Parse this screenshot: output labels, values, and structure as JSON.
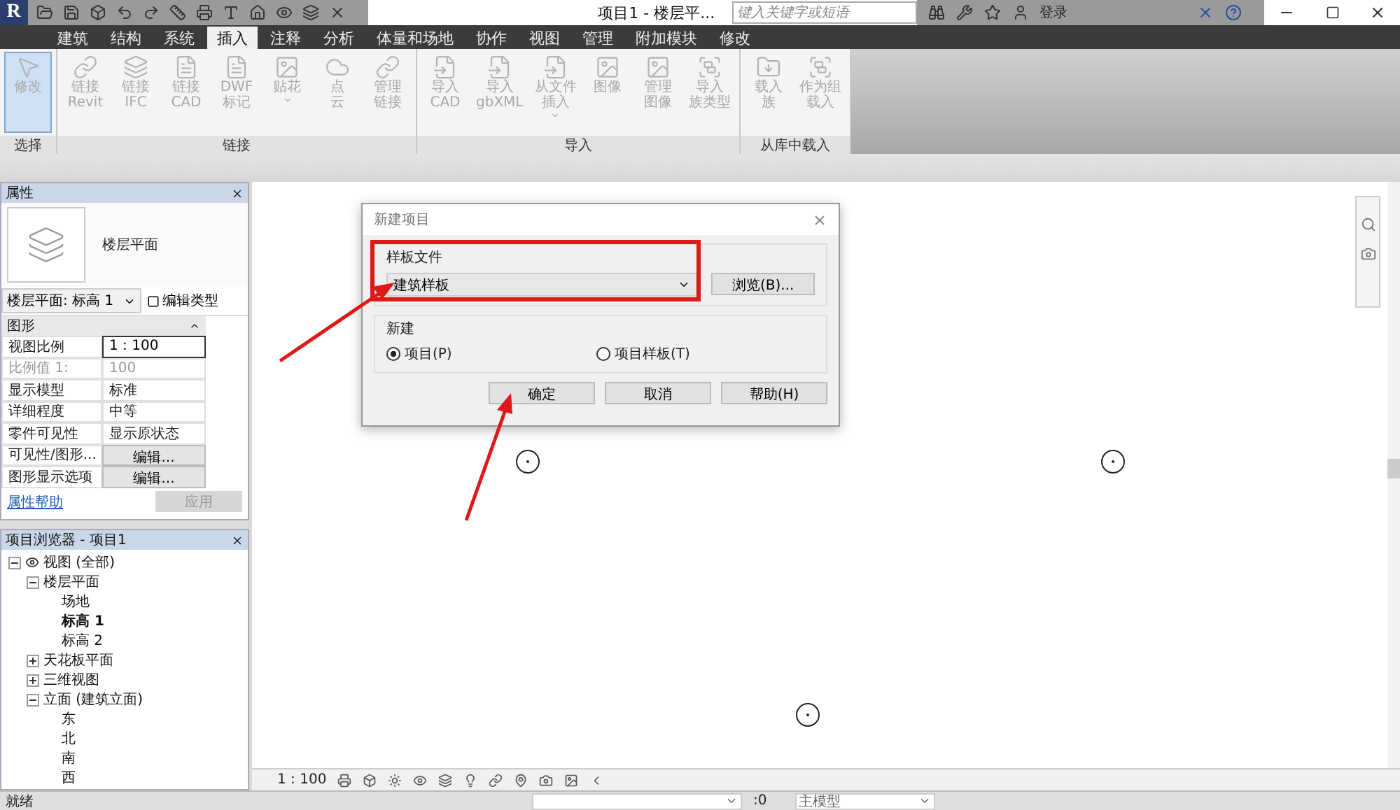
{
  "app": {
    "logo": "R",
    "title": "项目1 - 楼层平...",
    "search": {
      "placeholder": "键入关键字或短语"
    },
    "user": "登录"
  },
  "ribbon_tabs": [
    {
      "label": "建筑",
      "selected": false
    },
    {
      "label": "结构",
      "selected": false
    },
    {
      "label": "系统",
      "selected": false
    },
    {
      "label": "插入",
      "selected": true
    },
    {
      "label": "注释",
      "selected": false
    },
    {
      "label": "分析",
      "selected": false
    },
    {
      "label": "体量和场地",
      "selected": false
    },
    {
      "label": "协作",
      "selected": false
    },
    {
      "label": "视图",
      "selected": false
    },
    {
      "label": "管理",
      "selected": false
    },
    {
      "label": "附加模块",
      "selected": false
    },
    {
      "label": "修改",
      "selected": false
    }
  ],
  "ribbon_panels": [
    {
      "title": "选择",
      "buttons": [
        {
          "lines": [
            "修改"
          ],
          "selected": true,
          "menu": false
        }
      ]
    },
    {
      "title": "链接",
      "buttons": [
        {
          "lines": [
            "链接",
            "Revit"
          ],
          "selected": false,
          "menu": false
        },
        {
          "lines": [
            "链接",
            "IFC"
          ],
          "selected": false,
          "menu": false
        },
        {
          "lines": [
            "链接",
            "CAD"
          ],
          "selected": false,
          "menu": false
        },
        {
          "lines": [
            "DWF",
            "标记"
          ],
          "selected": false,
          "menu": false
        },
        {
          "lines": [
            "贴花"
          ],
          "selected": false,
          "menu": true
        },
        {
          "lines": [
            "点",
            "云"
          ],
          "selected": false,
          "menu": false
        },
        {
          "lines": [
            "管理",
            "链接"
          ],
          "selected": false,
          "menu": false
        }
      ]
    },
    {
      "title": "导入",
      "buttons": [
        {
          "lines": [
            "导入",
            "CAD"
          ],
          "selected": false,
          "menu": false
        },
        {
          "lines": [
            "导入",
            "gbXML"
          ],
          "selected": false,
          "menu": false
        },
        {
          "lines": [
            "从文件",
            "插入"
          ],
          "selected": false,
          "menu": true
        },
        {
          "lines": [
            "图像"
          ],
          "selected": false,
          "menu": false
        },
        {
          "lines": [
            "管理",
            "图像"
          ],
          "selected": false,
          "menu": false
        },
        {
          "lines": [
            "导入",
            "族类型"
          ],
          "selected": false,
          "menu": false
        }
      ]
    },
    {
      "title": "从库中载入",
      "buttons": [
        {
          "lines": [
            "载入",
            "族"
          ],
          "selected": false,
          "menu": false
        },
        {
          "lines": [
            "作为组",
            "载入"
          ],
          "selected": false,
          "menu": false
        }
      ]
    }
  ],
  "properties": {
    "title": "属性",
    "type_name": "楼层平面",
    "selector": "楼层平面: 标高 1",
    "edit_type": "编辑类型",
    "group": "图形",
    "rows": [
      {
        "label": "视图比例",
        "value": "1 : 100",
        "kind": "input",
        "disabled": false
      },
      {
        "label": "比例值 1:",
        "value": "100",
        "kind": "text",
        "disabled": true
      },
      {
        "label": "显示模型",
        "value": "标准",
        "kind": "text",
        "disabled": false
      },
      {
        "label": "详细程度",
        "value": "中等",
        "kind": "text",
        "disabled": false
      },
      {
        "label": "零件可见性",
        "value": "显示原状态",
        "kind": "text",
        "disabled": false
      },
      {
        "label": "可见性/图形...",
        "value": "编辑...",
        "kind": "button",
        "disabled": false
      },
      {
        "label": "图形显示选项",
        "value": "编辑...",
        "kind": "button",
        "disabled": false
      }
    ],
    "help_link": "属性帮助",
    "apply": "应用"
  },
  "browser": {
    "title": "项目浏览器 - 项目1",
    "tree": [
      {
        "label": "视图 (全部)",
        "expanded": true,
        "active": false,
        "children": [
          {
            "label": "楼层平面",
            "expanded": true,
            "active": false,
            "children": [
              {
                "label": "场地",
                "active": false
              },
              {
                "label": "标高 1",
                "active": true
              },
              {
                "label": "标高 2",
                "active": false
              }
            ]
          },
          {
            "label": "天花板平面",
            "expanded": false,
            "active": false
          },
          {
            "label": "三维视图",
            "expanded": false,
            "active": false
          },
          {
            "label": "立面 (建筑立面)",
            "expanded": true,
            "active": false,
            "children": [
              {
                "label": "东",
                "active": false
              },
              {
                "label": "北",
                "active": false
              },
              {
                "label": "南",
                "active": false
              },
              {
                "label": "西",
                "active": false
              }
            ]
          }
        ]
      }
    ]
  },
  "dialog": {
    "title": "新建项目",
    "template_group": "样板文件",
    "template": "建筑样板",
    "browse": "浏览(B)...",
    "new_group": "新建",
    "options": [
      {
        "label": "项目(P)",
        "selected": true
      },
      {
        "label": "项目样板(T)",
        "selected": false
      }
    ],
    "buttons": [
      "确定",
      "取消",
      "帮助(H)"
    ]
  },
  "view_bar": {
    "scale": "1 : 100"
  },
  "status_bar": {
    "message": "就绪",
    "count": ":0",
    "model": "主模型"
  }
}
